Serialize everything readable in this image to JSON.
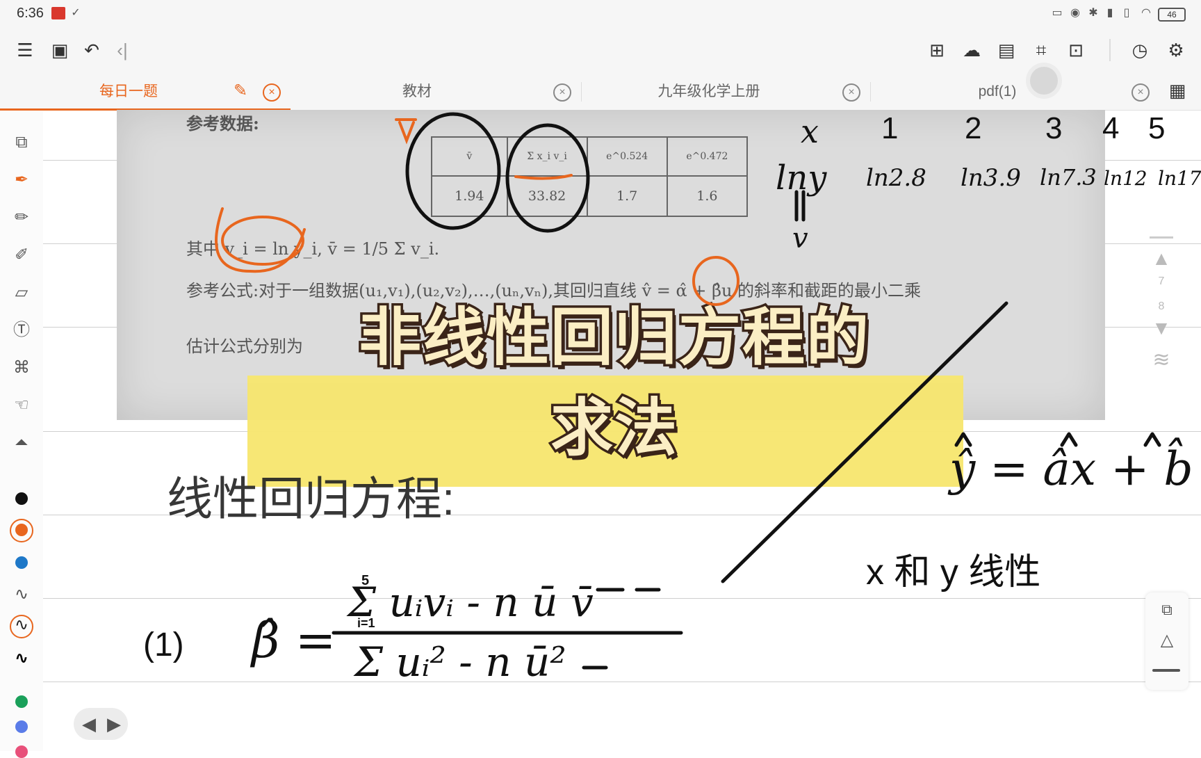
{
  "status_bar": {
    "time": "6:36",
    "battery": "46"
  },
  "toolbar": {
    "left_icons": [
      "menu-icon",
      "read-mode-icon",
      "undo-icon",
      "collapse-icon"
    ],
    "right_icons": [
      "add-page-icon",
      "cloud-sync-icon",
      "paper-style-icon",
      "crop-icon",
      "add-note-icon",
      "history-icon",
      "settings-icon"
    ]
  },
  "tabs": [
    {
      "label": "每日一题",
      "active": true
    },
    {
      "label": "教材",
      "active": false
    },
    {
      "label": "九年级化学上册",
      "active": false
    },
    {
      "label": "pdf(1)",
      "active": false
    }
  ],
  "colors": {
    "accent": "#e8661e",
    "highlight": "#f7e66e",
    "pen_black": "#111111",
    "pen_orange": "#e8661e",
    "pen_blue": "#1e78c8",
    "pen_green": "#1aa05a",
    "pen_lightblue": "#5a7ce8"
  },
  "photo": {
    "heading": "参考数据:",
    "table_headers": [
      "v̄",
      "Σ x_i v_i",
      "e^0.524",
      "e^0.472"
    ],
    "table_values": [
      "1.94",
      "33.82",
      "1.7",
      "1.6"
    ],
    "line1": "其中 v_i = ln y_i, v̄ = 1/5 Σ v_i.",
    "line2": "参考公式:对于一组数据(u₁,v₁),(u₂,v₂),…,(uₙ,vₙ),其回归直线 v̂ = α̂ + β̂u 的斜率和截距的最小二乘",
    "line3": "估计公式分别为"
  },
  "title": {
    "line1": "非线性回归方程的",
    "line2": "求法"
  },
  "handwriting": {
    "x_row": [
      "x",
      "1",
      "2",
      "3",
      "4",
      "5"
    ],
    "lny_row": [
      "lny",
      "ln2.8",
      "ln3.9",
      "ln7.3",
      "ln12",
      "ln17"
    ],
    "v_label": "v",
    "linear_eq_label": "线性回归方程:",
    "yhat_eq": "ŷ = âx + b̂",
    "xy_linear": "x 和 y 线性",
    "item1": "(1)",
    "beta_hat": "β̂ =",
    "numerator": "Σ uᵢvᵢ - n ū v̄",
    "denominator": "Σ uᵢ² - n ū²",
    "sum_upper": "5",
    "sum_lower": "i=1"
  },
  "page_indicator": {
    "current": "7",
    "total": "8"
  }
}
